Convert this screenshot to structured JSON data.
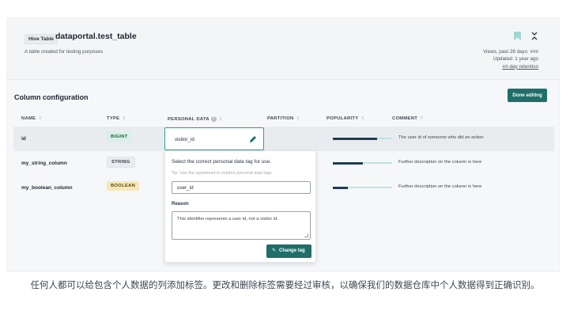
{
  "header": {
    "badge": "Hive Table",
    "title": "dataportal.test_table",
    "description": "A table created for testing purposes",
    "views": "Views, past 28 days: ###",
    "updated": "Updated: 1 year ago",
    "retention": "##-day retention",
    "icons": [
      "bookmark-icon",
      "collapse-icon"
    ]
  },
  "section": {
    "title": "Column configuration",
    "done_label": "Done editing"
  },
  "columns": {
    "name": "NAME",
    "type": "TYPE",
    "personal_data": "PERSONAL DATA",
    "partition": "PARTITION",
    "popularity": "POPULARITY",
    "comment": "COMMENT"
  },
  "rows": [
    {
      "name": "id",
      "type": "BIGINT",
      "popularity": 0.75,
      "comment": "The user id of someone who did an action"
    },
    {
      "name": "my_string_column",
      "type": "STRING",
      "popularity": 0.5,
      "comment": "Further description on the column is here"
    },
    {
      "name": "my_boolean_column",
      "type": "BOOLEAN",
      "popularity": 0.25,
      "comment": "Further description on the column is here"
    }
  ],
  "tag_editor": {
    "current_value": "visitor_id",
    "instruction": "Select the correct personal data tag for use.",
    "tip": "Tip: Use the typeahead to explore personal data tags",
    "input_value": "user_id",
    "reason_label": "Reason",
    "reason_text": "This identifier represents a user id, not a visitor id.",
    "button_label": "Change tag"
  },
  "colors": {
    "accent": "#1f6e6a",
    "popularity_fill": "#1d3d52",
    "popularity_track": "#bfe3e5"
  },
  "caption": "任何人都可以给包含个人数据的列添加标签。更改和删除标签需要经过审核，以确保我们的数据仓库中个人数据得到正确识别。"
}
